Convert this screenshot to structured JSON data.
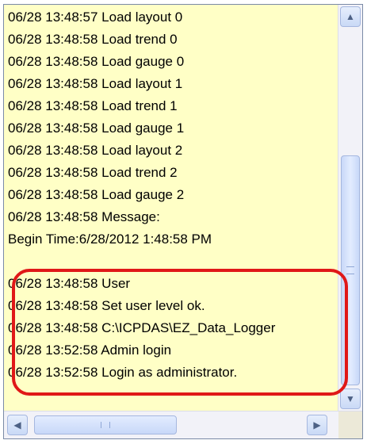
{
  "log": {
    "lines": [
      "06/28 13:48:57  Load layout 0",
      "06/28 13:48:58  Load trend 0",
      "06/28 13:48:58  Load gauge 0",
      "06/28 13:48:58  Load layout 1",
      "06/28 13:48:58  Load trend 1",
      "06/28 13:48:58  Load gauge 1",
      "06/28 13:48:58  Load layout 2",
      "06/28 13:48:58  Load trend 2",
      "06/28 13:48:58  Load gauge 2",
      "06/28 13:48:58  Message:",
      "Begin Time:6/28/2012 1:48:58 PM",
      "",
      "06/28 13:48:58  User",
      "06/28 13:48:58  Set user level ok.",
      "06/28 13:48:58  C:\\ICPDAS\\EZ_Data_Logger",
      "06/28 13:52:58  Admin login",
      "06/28 13:52:58  Login as administrator."
    ]
  },
  "scroll": {
    "up_icon": "▲",
    "down_icon": "▼",
    "left_icon": "◀",
    "right_icon": "▶"
  }
}
